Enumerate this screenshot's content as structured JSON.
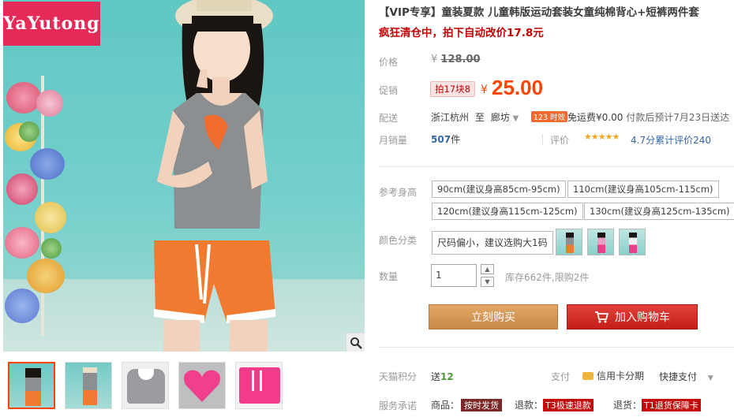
{
  "brand": {
    "logo_text": "YaYutong"
  },
  "product": {
    "title": "【VIP专享】童装夏款 儿童韩版运动套装女童纯棉背心+短裤两件套",
    "subtitle": "疯狂清仓中，拍下自动改价17.8元"
  },
  "price": {
    "label": "价格",
    "currency": "¥",
    "original": "128.00"
  },
  "promo": {
    "label": "促销",
    "badge": "拍17块8",
    "currency": "¥",
    "price": "25.00"
  },
  "shipping": {
    "label": "配送",
    "from": "浙江杭州",
    "to_word": "至",
    "destination": "廊坊",
    "badge": "123 时效",
    "fee": "免运费¥0.00",
    "estimate": "付款后预计7月23日送达"
  },
  "sales": {
    "label": "月销量",
    "count": "507",
    "unit": "件",
    "rating_label": "评价",
    "stars": "★★★★★",
    "rating_text": "4.7分累计评价240"
  },
  "size": {
    "label": "参考身高",
    "options": [
      "90cm(建议身高85cm-95cm)",
      "110cm(建议身高105cm-115cm)",
      "120cm(建议身高115cm-125cm)",
      "130cm(建议身高125cm-135cm)"
    ]
  },
  "color": {
    "label": "颜色分类",
    "text_option": "尺码偏小，建议选购大1码"
  },
  "quantity": {
    "label": "数量",
    "value": "1",
    "stock": "库存662件,限购2件"
  },
  "actions": {
    "buy_now": "立刻购买",
    "add_to_cart": "加入购物车"
  },
  "points": {
    "label": "天猫积分",
    "value_prefix": "送",
    "value": "12",
    "pay_label": "支付",
    "credit": "信用卡分期",
    "express_pay": "快捷支付"
  },
  "service": {
    "label": "服务承诺",
    "goods_prefix": "商品：",
    "goods_tag": "按时发货",
    "refund_prefix": "退款：",
    "refund_tag": "T3极速退款",
    "return_prefix": "退货：",
    "return_tag": "T1退货保障卡"
  },
  "colors": {
    "accent": "#ff4400",
    "title_red": "#c40000",
    "buy": "#d69a5a",
    "cart": "#c31f18"
  }
}
